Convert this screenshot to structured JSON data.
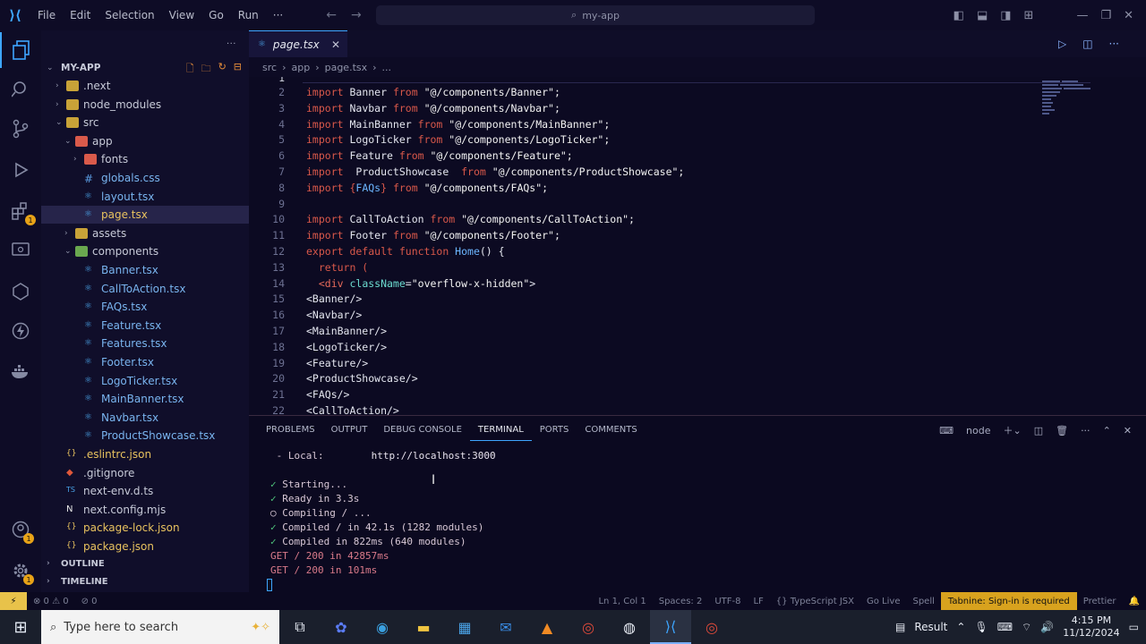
{
  "titlebar": {
    "menu": [
      "File",
      "Edit",
      "Selection",
      "View",
      "Go",
      "Run",
      "···"
    ],
    "search_text": "my-app"
  },
  "sidebar": {
    "project": "MY-APP",
    "items": [
      {
        "label": ".next",
        "depth": 1,
        "kind": "folder",
        "chev": "›"
      },
      {
        "label": "node_modules",
        "depth": 1,
        "kind": "folder",
        "chev": "›"
      },
      {
        "label": "src",
        "depth": 1,
        "kind": "folder-open",
        "chev": "⌄"
      },
      {
        "label": "app",
        "depth": 2,
        "kind": "folder-red",
        "chev": "⌄"
      },
      {
        "label": "fonts",
        "depth": 3,
        "kind": "folder-red",
        "chev": "›"
      },
      {
        "label": "globals.css",
        "depth": 3,
        "kind": "css"
      },
      {
        "label": "layout.tsx",
        "depth": 3,
        "kind": "tsx"
      },
      {
        "label": "page.tsx",
        "depth": 3,
        "kind": "tsx",
        "selected": true
      },
      {
        "label": "assets",
        "depth": 2,
        "kind": "folder",
        "chev": "›"
      },
      {
        "label": "components",
        "depth": 2,
        "kind": "folder-green",
        "chev": "⌄"
      },
      {
        "label": "Banner.tsx",
        "depth": 3,
        "kind": "tsx"
      },
      {
        "label": "CallToAction.tsx",
        "depth": 3,
        "kind": "tsx"
      },
      {
        "label": "FAQs.tsx",
        "depth": 3,
        "kind": "tsx"
      },
      {
        "label": "Feature.tsx",
        "depth": 3,
        "kind": "tsx"
      },
      {
        "label": "Features.tsx",
        "depth": 3,
        "kind": "tsx"
      },
      {
        "label": "Footer.tsx",
        "depth": 3,
        "kind": "tsx"
      },
      {
        "label": "LogoTicker.tsx",
        "depth": 3,
        "kind": "tsx"
      },
      {
        "label": "MainBanner.tsx",
        "depth": 3,
        "kind": "tsx"
      },
      {
        "label": "Navbar.tsx",
        "depth": 3,
        "kind": "tsx"
      },
      {
        "label": "ProductShowcase.tsx",
        "depth": 3,
        "kind": "tsx"
      },
      {
        "label": ".eslintrc.json",
        "depth": 1,
        "kind": "json"
      },
      {
        "label": ".gitignore",
        "depth": 1,
        "kind": "git"
      },
      {
        "label": "next-env.d.ts",
        "depth": 1,
        "kind": "ts"
      },
      {
        "label": "next.config.mjs",
        "depth": 1,
        "kind": "next"
      },
      {
        "label": "package-lock.json",
        "depth": 1,
        "kind": "json"
      },
      {
        "label": "package.json",
        "depth": 1,
        "kind": "json"
      }
    ],
    "outline": "OUTLINE",
    "timeline": "TIMELINE"
  },
  "editor": {
    "tab_label": "page.tsx",
    "breadcrumb": [
      "src",
      "app",
      "page.tsx",
      "..."
    ],
    "lines": [
      {
        "n": "2",
        "parts": [
          [
            "kw",
            "import "
          ],
          [
            "",
            "Banner "
          ],
          [
            "kw",
            "from "
          ],
          [
            "str",
            "\"@/components/Banner\";"
          ]
        ]
      },
      {
        "n": "3",
        "parts": [
          [
            "kw",
            "import "
          ],
          [
            "",
            "Navbar "
          ],
          [
            "kw",
            "from "
          ],
          [
            "str",
            "\"@/components/Navbar\";"
          ]
        ]
      },
      {
        "n": "4",
        "parts": [
          [
            "kw",
            "import "
          ],
          [
            "",
            "MainBanner "
          ],
          [
            "kw",
            "from "
          ],
          [
            "str",
            "\"@/components/MainBanner\";"
          ]
        ]
      },
      {
        "n": "5",
        "parts": [
          [
            "kw",
            "import "
          ],
          [
            "",
            "LogoTicker "
          ],
          [
            "kw",
            "from "
          ],
          [
            "str",
            "\"@/components/LogoTicker\";"
          ]
        ]
      },
      {
        "n": "6",
        "parts": [
          [
            "kw",
            "import "
          ],
          [
            "",
            "Feature "
          ],
          [
            "kw",
            "from "
          ],
          [
            "str",
            "\"@/components/Feature\";"
          ]
        ]
      },
      {
        "n": "7",
        "parts": [
          [
            "kw",
            "import  "
          ],
          [
            "",
            "ProductShowcase  "
          ],
          [
            "kw",
            "from "
          ],
          [
            "str",
            "\"@/components/ProductShowcase\";"
          ]
        ]
      },
      {
        "n": "8",
        "parts": [
          [
            "kw",
            "import "
          ],
          [
            "kw",
            "{"
          ],
          [
            "fn",
            "FAQs"
          ],
          [
            "kw",
            "} "
          ],
          [
            "kw",
            "from "
          ],
          [
            "str",
            "\"@/components/FAQs\";"
          ]
        ]
      },
      {
        "n": "9",
        "parts": []
      },
      {
        "n": "10",
        "parts": [
          [
            "kw",
            "import "
          ],
          [
            "",
            "CallToAction "
          ],
          [
            "kw",
            "from "
          ],
          [
            "str",
            "\"@/components/CallToAction\";"
          ]
        ]
      },
      {
        "n": "11",
        "parts": [
          [
            "kw",
            "import "
          ],
          [
            "",
            "Footer "
          ],
          [
            "kw",
            "from "
          ],
          [
            "str",
            "\"@/components/Footer\";"
          ]
        ]
      },
      {
        "n": "12",
        "parts": [
          [
            "kw",
            "export default function "
          ],
          [
            "fn",
            "Home"
          ],
          [
            "",
            "() {"
          ]
        ]
      },
      {
        "n": "13",
        "parts": [
          [
            "kw",
            "  return ("
          ]
        ]
      },
      {
        "n": "14",
        "parts": [
          [
            "tag",
            "  <div "
          ],
          [
            "attr",
            "className"
          ],
          [
            "",
            "="
          ],
          [
            "str",
            "\"overflow-x-hidden\""
          ],
          [
            "",
            ">"
          ]
        ]
      },
      {
        "n": "15",
        "parts": [
          [
            "",
            "<Banner/>"
          ]
        ]
      },
      {
        "n": "16",
        "parts": [
          [
            "",
            "<Navbar/>"
          ]
        ]
      },
      {
        "n": "17",
        "parts": [
          [
            "",
            "<MainBanner/>"
          ]
        ]
      },
      {
        "n": "18",
        "parts": [
          [
            "",
            "<LogoTicker/>"
          ]
        ]
      },
      {
        "n": "19",
        "parts": [
          [
            "",
            "<Feature/>"
          ]
        ]
      },
      {
        "n": "20",
        "parts": [
          [
            "",
            "<ProductShowcase/>"
          ]
        ]
      },
      {
        "n": "21",
        "parts": [
          [
            "",
            "<FAQs/>"
          ]
        ]
      },
      {
        "n": "22",
        "parts": [
          [
            "",
            "<CallToAction/>"
          ]
        ]
      }
    ]
  },
  "panel": {
    "tabs": [
      "PROBLEMS",
      "OUTPUT",
      "DEBUG CONSOLE",
      "TERMINAL",
      "PORTS",
      "COMMENTS"
    ],
    "active_tab": "TERMINAL",
    "terminal_name": "node",
    "terminal_lines": [
      {
        "mark": "",
        "text": " - Local:        ",
        "link": "http://localhost:3000"
      },
      {
        "mark": "",
        "text": "",
        "link": ""
      },
      {
        "mark": "✓",
        "text": " Starting...",
        "link": ""
      },
      {
        "mark": "✓",
        "text": " Ready in 3.3s",
        "link": ""
      },
      {
        "mark": "○",
        "text": " Compiling / ...",
        "link": ""
      },
      {
        "mark": "✓",
        "text": " Compiled / in 42.1s (1282 modules)",
        "link": ""
      },
      {
        "mark": "✓",
        "text": " Compiled in 822ms (640 modules)",
        "link": ""
      },
      {
        "mark": "",
        "text": "GET / 200 in 42857ms",
        "link": ""
      },
      {
        "mark": "",
        "text": "GET / 200 in 101ms",
        "link": ""
      }
    ]
  },
  "status": {
    "errors": "⊗ 0 ⚠ 0",
    "ports": "⊘ 0",
    "position": "Ln 1, Col 1",
    "spaces": "Spaces: 2",
    "encoding": "UTF-8",
    "eol": "LF",
    "language": "{} TypeScript JSX",
    "golive": "Go Live",
    "spell": "Spell",
    "tabnine": "Tabnine: Sign-in is required",
    "prettier": "Prettier"
  },
  "taskbar": {
    "search_placeholder": "Type here to search",
    "tray_label": "Result",
    "time": "4:15 PM",
    "date": "11/12/2024"
  },
  "colors": {
    "accent": "#3ea6ff",
    "keyword": "#d9584a",
    "terminal_green": "#4ec27a",
    "tabnine": "#d8a21e"
  }
}
